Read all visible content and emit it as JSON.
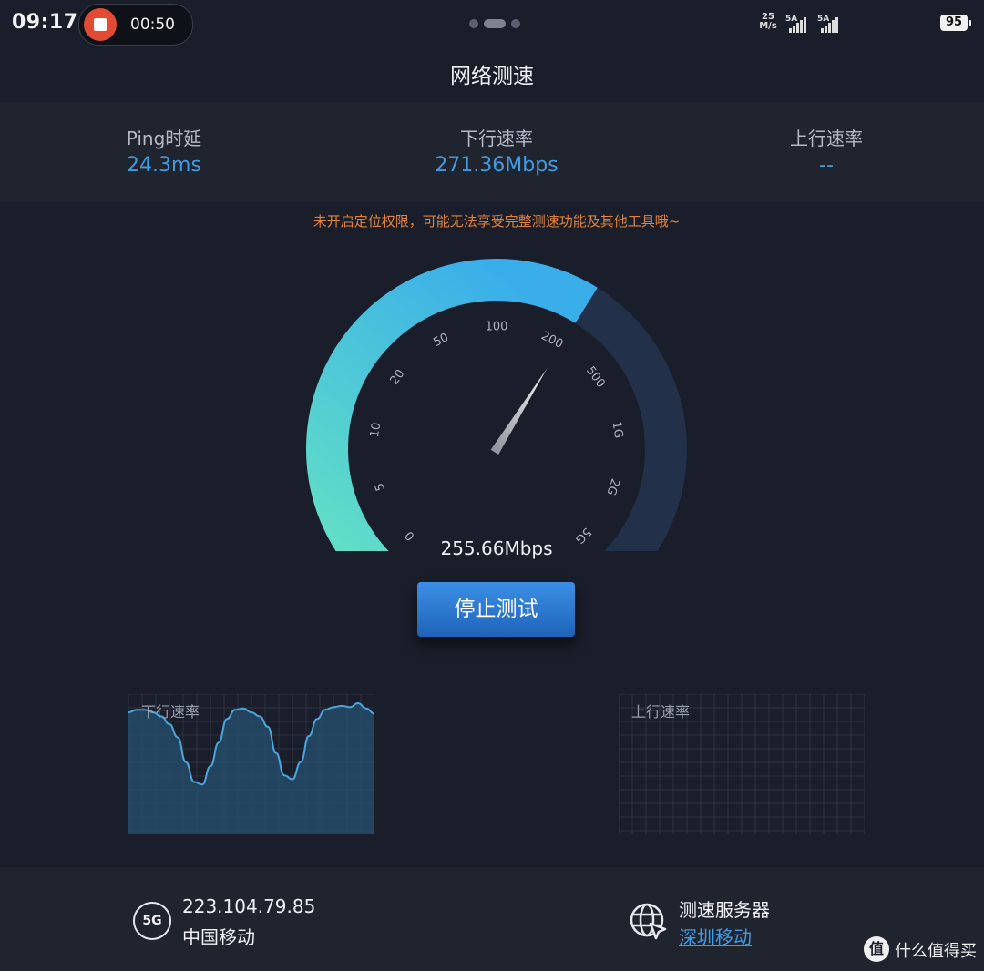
{
  "status_bar": {
    "time": "09:17",
    "record_time": "00:50",
    "net_rate": "25",
    "net_rate_unit": "M/s",
    "signal1": "5A",
    "signal2": "5A",
    "battery": "95"
  },
  "title": "网络测速",
  "stats": {
    "ping": {
      "label": "Ping时延",
      "value": "24.3ms"
    },
    "download": {
      "label": "下行速率",
      "value": "271.36Mbps"
    },
    "upload": {
      "label": "上行速率",
      "value": "--"
    }
  },
  "warning": "未开启定位权限，可能无法享受完整测速功能及其他工具哦~",
  "gauge": {
    "ticks": [
      "0",
      "5",
      "10",
      "20",
      "50",
      "100",
      "200",
      "500",
      "1G",
      "2G",
      "5G"
    ],
    "current_mbps": 255.66,
    "reading": "255.66Mbps",
    "accent": "#3fb0ea",
    "track": "#223049"
  },
  "stop_button": "停止测试",
  "charts": {
    "download_label": "下行速率",
    "upload_label": "上行速率",
    "download_series": [
      0.93,
      0.95,
      0.95,
      0.93,
      0.9,
      0.84,
      0.74,
      0.55,
      0.4,
      0.38,
      0.52,
      0.7,
      0.88,
      0.95,
      0.96,
      0.93,
      0.9,
      0.82,
      0.62,
      0.45,
      0.42,
      0.55,
      0.75,
      0.88,
      0.95,
      0.97,
      0.98,
      0.97,
      1.0,
      0.96,
      0.92
    ]
  },
  "footer": {
    "network_type": "5G",
    "ip": "223.104.79.85",
    "carrier": "中国移动",
    "server_label": "测速服务器",
    "server_value": "深圳移动"
  },
  "watermark": {
    "logo": "值",
    "text": "什么值得买"
  }
}
